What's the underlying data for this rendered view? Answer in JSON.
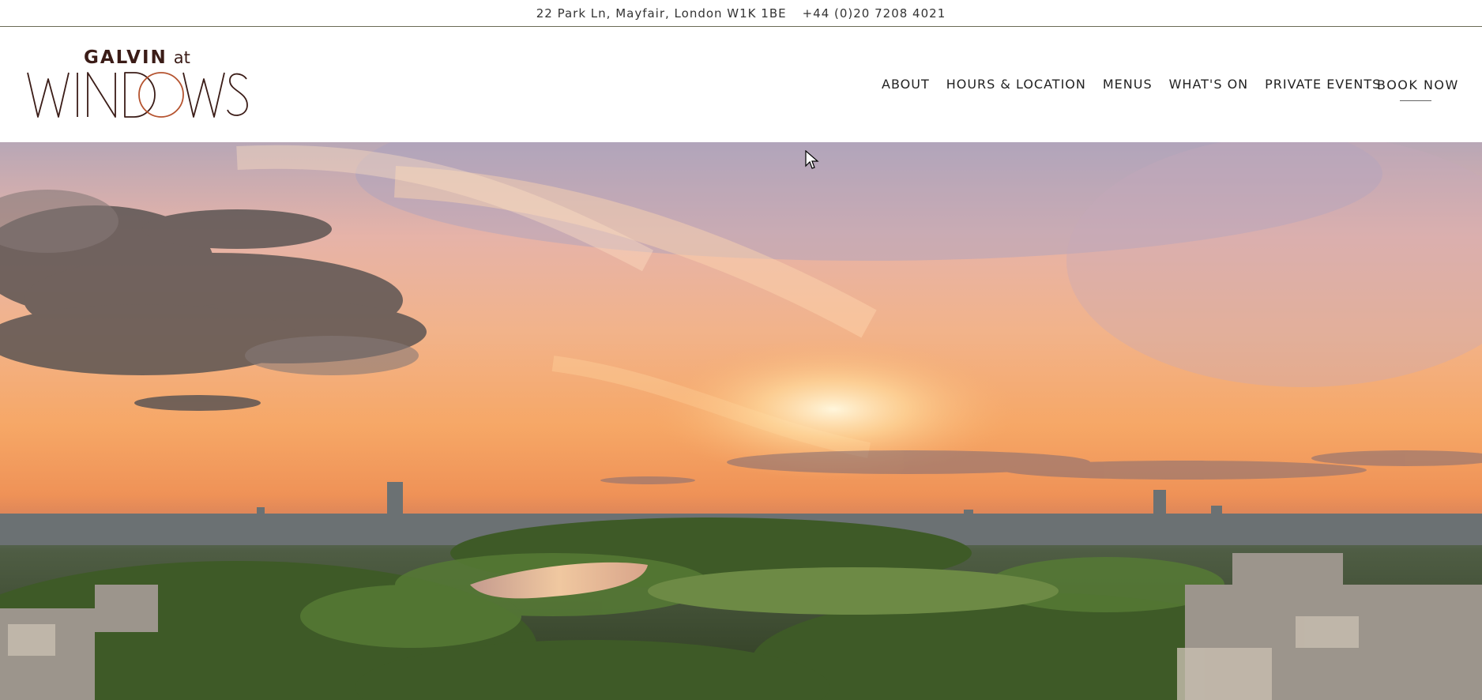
{
  "topbar": {
    "address": "22 Park Ln, Mayfair, London W1K 1BE",
    "phone": "+44 (0)20 7208 4021"
  },
  "logo": {
    "galvin": "GALVIN",
    "at": "at",
    "windows": "WINDOWS"
  },
  "nav": {
    "items": [
      {
        "label": "ABOUT"
      },
      {
        "label": "HOURS & LOCATION"
      },
      {
        "label": "MENUS"
      },
      {
        "label": "WHAT'S ON"
      },
      {
        "label": "PRIVATE EVENTS"
      }
    ],
    "book_label": "BOOK NOW"
  },
  "hero": {
    "scene": "sunset-over-london-park-photo"
  },
  "colors": {
    "brand_dark": "#3b1c17",
    "brand_accent": "#b5532f"
  }
}
